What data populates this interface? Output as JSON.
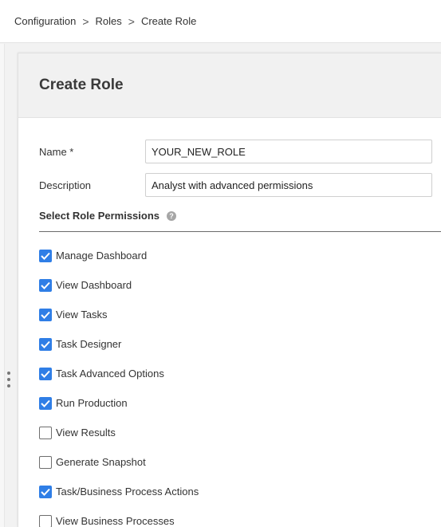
{
  "breadcrumb": {
    "items": [
      "Configuration",
      "Roles",
      "Create Role"
    ],
    "separator": ">"
  },
  "page": {
    "title": "Create Role"
  },
  "form": {
    "name_label": "Name *",
    "name_value": "YOUR_NEW_ROLE",
    "description_label": "Description",
    "description_value": "Analyst with advanced permissions"
  },
  "permissions": {
    "title": "Select Role Permissions",
    "help_icon": "?",
    "items": [
      {
        "label": "Manage Dashboard",
        "checked": true
      },
      {
        "label": "View Dashboard",
        "checked": true
      },
      {
        "label": "View Tasks",
        "checked": true
      },
      {
        "label": "Task Designer",
        "checked": true
      },
      {
        "label": "Task Advanced Options",
        "checked": true
      },
      {
        "label": "Run Production",
        "checked": true
      },
      {
        "label": "View Results",
        "checked": false
      },
      {
        "label": "Generate Snapshot",
        "checked": false
      },
      {
        "label": "Task/Business Process Actions",
        "checked": true
      },
      {
        "label": "View Business Processes",
        "checked": false
      }
    ]
  },
  "colors": {
    "accent": "#2f7ee6",
    "header_bg": "#f1f1f1",
    "page_bg": "#f2f2f2"
  }
}
